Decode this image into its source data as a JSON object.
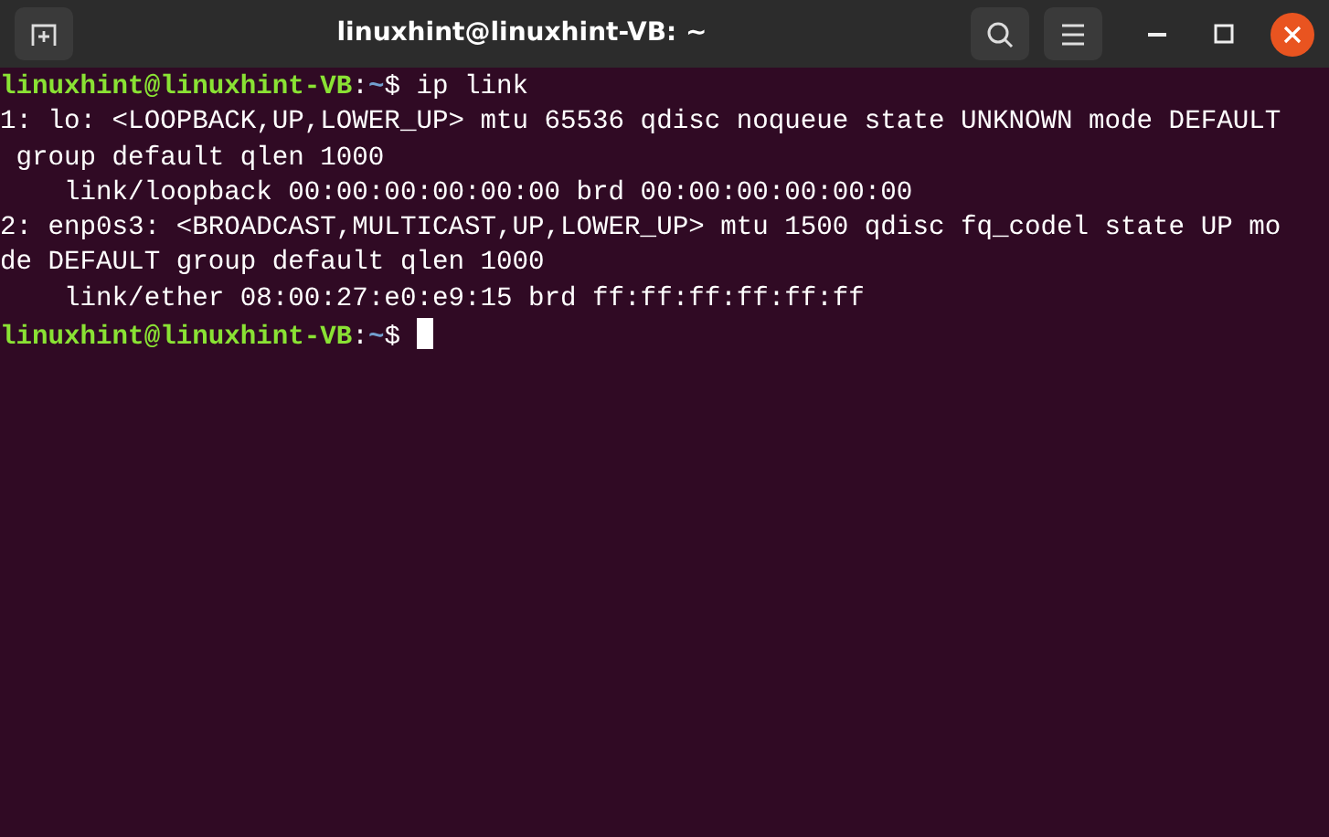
{
  "window": {
    "title": "linuxhint@linuxhint-VB: ~"
  },
  "terminal": {
    "lines": [
      {
        "kind": "prompt",
        "user": "linuxhint@linuxhint-VB",
        "separator": ":",
        "path": "~",
        "symbol": "$",
        "command": "ip link"
      },
      {
        "kind": "output",
        "text": "1: lo: <LOOPBACK,UP,LOWER_UP> mtu 65536 qdisc noqueue state UNKNOWN mode DEFAULT"
      },
      {
        "kind": "output",
        "text": " group default qlen 1000"
      },
      {
        "kind": "output",
        "text": "    link/loopback 00:00:00:00:00:00 brd 00:00:00:00:00:00"
      },
      {
        "kind": "output",
        "text": "2: enp0s3: <BROADCAST,MULTICAST,UP,LOWER_UP> mtu 1500 qdisc fq_codel state UP mo"
      },
      {
        "kind": "output",
        "text": "de DEFAULT group default qlen 1000"
      },
      {
        "kind": "output",
        "text": "    link/ether 08:00:27:e0:e9:15 brd ff:ff:ff:ff:ff:ff"
      },
      {
        "kind": "prompt",
        "user": "linuxhint@linuxhint-VB",
        "separator": ":",
        "path": "~",
        "symbol": "$",
        "cursor": true
      }
    ]
  }
}
